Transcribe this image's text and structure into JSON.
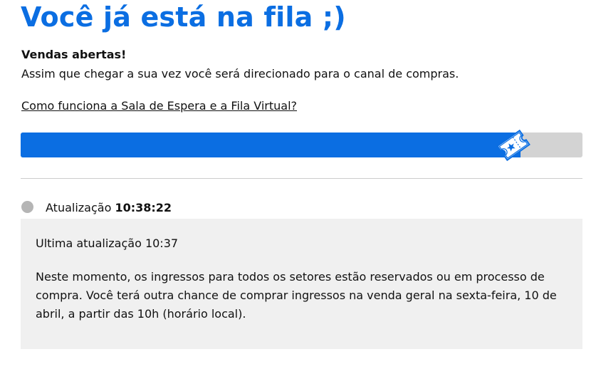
{
  "header": {
    "title": "Você já está na fila ;)"
  },
  "status": {
    "heading": "Vendas abertas!",
    "text": "Assim que chegar a sua vez você será direcionado para o canal de compras.",
    "help_link": "Como funciona a Sala de Espera e a Fila Virtual?"
  },
  "progress": {
    "percent": 89,
    "fill_color": "#0b6ee2",
    "track_color": "#d3d3d3",
    "icon": "ticket-icon"
  },
  "update": {
    "label": "Atualização",
    "time": "10:38:22",
    "indicator_color": "#b5b5b5"
  },
  "info": {
    "heading": "Ultima atualização 10:37",
    "body": "Neste momento, os ingressos para todos os setores estão reservados ou em processo de compra. Você terá outra chance de comprar ingressos na venda geral na sexta-feira, 10 de abril, a partir das 10h (horário local)."
  },
  "colors": {
    "accent": "#0b6ee2",
    "panel_bg": "#f0f0f0"
  }
}
